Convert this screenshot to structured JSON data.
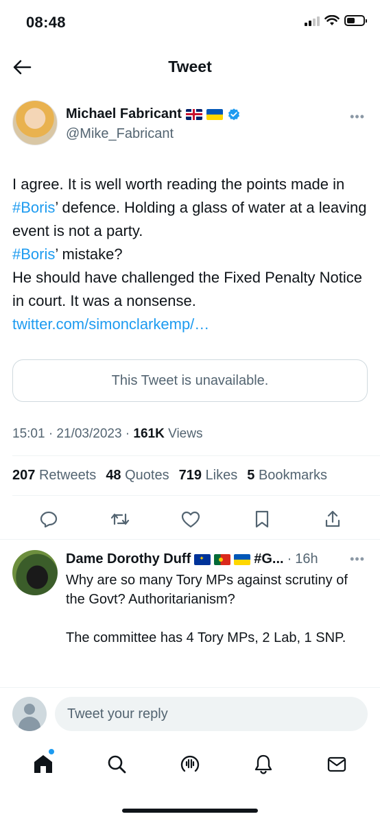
{
  "status_bar": {
    "time": "08:48"
  },
  "nav": {
    "title": "Tweet"
  },
  "tweet": {
    "author_name": "Michael Fabricant",
    "author_handle": "@Mike_Fabricant",
    "text_parts": {
      "p1": "I agree.  It is well worth reading the points made in ",
      "tag1": "#Boris",
      "p2": "’ defence. Holding a glass of water at a leaving event is not a party.",
      "tag2": "#Boris",
      "p3": "’ mistake?",
      "p4": "He should have challenged the Fixed Penalty Notice in court. It was a nonsense.",
      "link": "twitter.com/simonclarkemp/…"
    },
    "quote_unavailable": "This Tweet is unavailable.",
    "timestamp": "15:01 · 21/03/2023 · ",
    "views_count": "161K",
    "views_label": " Views",
    "stats": {
      "retweets_count": "207",
      "retweets_label": "Retweets",
      "quotes_count": "48",
      "quotes_label": "Quotes",
      "likes_count": "719",
      "likes_label": "Likes",
      "bookmarks_count": "5",
      "bookmarks_label": "Bookmarks"
    }
  },
  "reply": {
    "author_name": "Dame Dorothy Duff",
    "name_suffix": "#G...",
    "time": "16h",
    "dot": "·",
    "text": "Why are so many Tory MPs against scrutiny of the Govt? Authoritarianism?\n\nThe committee has 4 Tory MPs, 2 Lab, 1 SNP."
  },
  "reply_bar": {
    "placeholder": "Tweet your reply"
  },
  "colors": {
    "accent": "#1d9bf0",
    "text": "#0f1419",
    "secondary": "#536471"
  },
  "icons": {
    "tabbar": [
      "home-icon",
      "search-icon",
      "spaces-icon",
      "notifications-icon",
      "messages-icon"
    ],
    "actions": [
      "reply-icon",
      "retweet-icon",
      "like-icon",
      "bookmark-icon",
      "share-icon"
    ]
  }
}
